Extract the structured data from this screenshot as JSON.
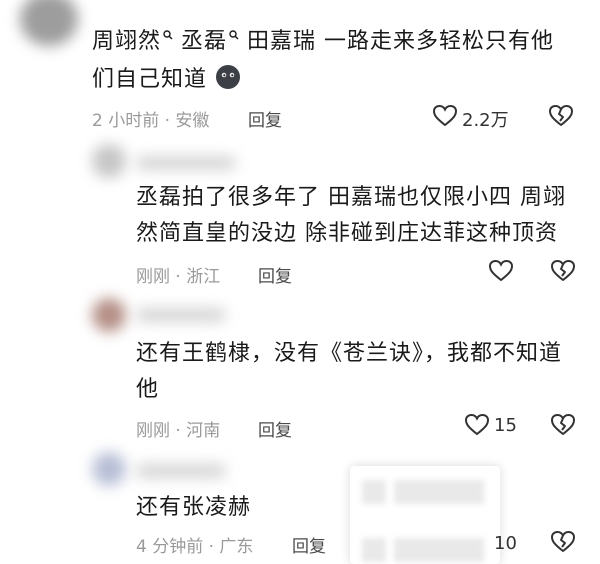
{
  "comments": [
    {
      "mentions": [
        "周翊然",
        "丞磊"
      ],
      "text_rest": "田嘉瑞 一路走来多轻松只有他",
      "text_line2": "们自己知道",
      "meta": "2 小时前 · 安徽",
      "reply_label": "回复",
      "like_count": "2.2万"
    },
    {
      "text_line1": "丞磊拍了很多年了 田嘉瑞也仅限小四 周翊",
      "text_line2": "然简直皇的没边 除非碰到庄达菲这种顶资",
      "meta": "刚刚 · 浙江",
      "reply_label": "回复"
    },
    {
      "text_line1": "还有王鹤棣，没有《苍兰诀》，我都不知道",
      "text_line2": "他",
      "meta": "刚刚 · 河南",
      "reply_label": "回复",
      "like_count": "15"
    },
    {
      "text_line1": "还有张凌赫",
      "meta": "4 分钟前 · 广东",
      "reply_label": "回复",
      "like_count": "10"
    }
  ],
  "icons": {
    "like": "heart-outline-icon",
    "dislike": "broken-heart-icon",
    "emoji": "dark-face-emoji-icon",
    "mention_marker": "magnifier-icon"
  }
}
